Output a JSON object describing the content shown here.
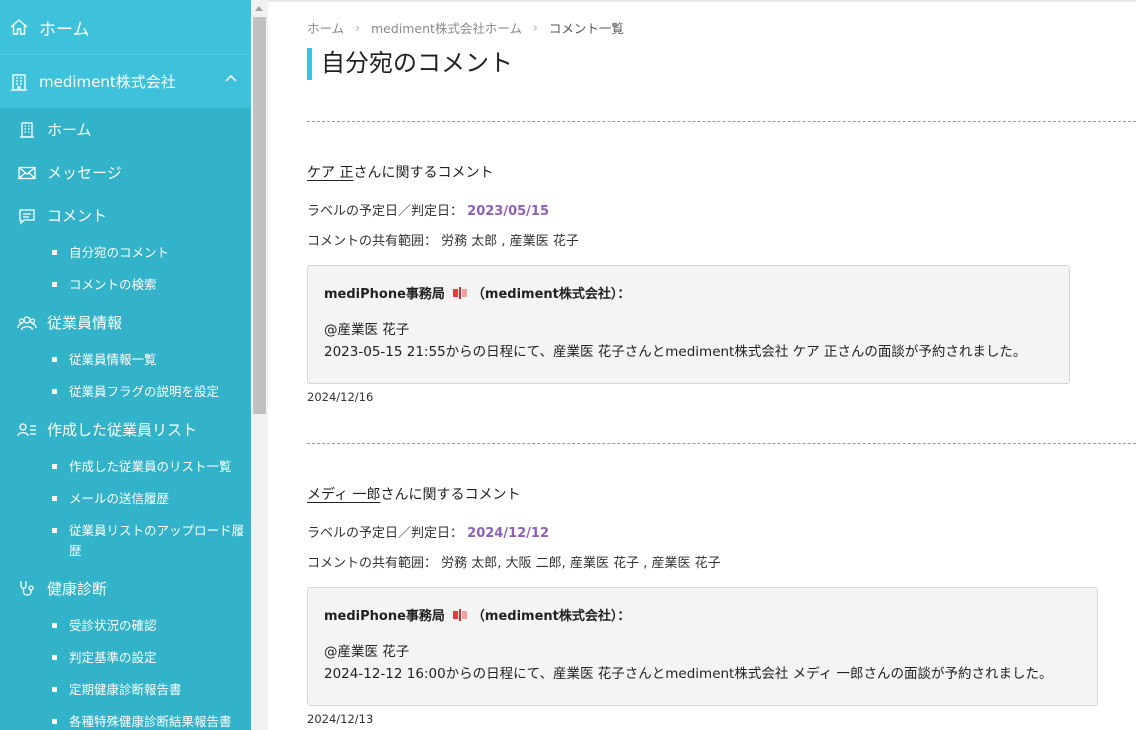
{
  "sidebar": {
    "home": "ホーム",
    "company": "mediment株式会社",
    "items": [
      {
        "label": "ホーム"
      },
      {
        "label": "メッセージ"
      },
      {
        "label": "コメント"
      },
      {
        "label": "自分宛のコメント"
      },
      {
        "label": "コメントの検索"
      },
      {
        "label": "従業員情報"
      },
      {
        "label": "従業員情報一覧"
      },
      {
        "label": "従業員フラグの説明を設定"
      },
      {
        "label": "作成した従業員リスト"
      },
      {
        "label": "作成した従業員のリスト一覧"
      },
      {
        "label": "メールの送信履歴"
      },
      {
        "label": "従業員リストのアップロード履歴"
      },
      {
        "label": "健康診断"
      },
      {
        "label": "受診状況の確認"
      },
      {
        "label": "判定基準の設定"
      },
      {
        "label": "定期健康診断報告書"
      },
      {
        "label": "各種特殊健康診断結果報告書"
      }
    ]
  },
  "breadcrumb": {
    "home": "ホーム",
    "company_home": "mediment株式会社ホーム",
    "current": "コメント一覧",
    "separator": "›"
  },
  "page": {
    "title": "自分宛のコメント"
  },
  "labels": {
    "label_date": "ラベルの予定日／判定日：",
    "share_scope": "コメントの共有範囲：",
    "about_suffix": "さんに関するコメント"
  },
  "comments": [
    {
      "employee": "ケア 正",
      "date": "2023/05/15",
      "scope": "労務 太郎 , 産業医 花子",
      "sender": "mediPhone事務局",
      "sender_org": "（mediment株式会社）：",
      "mention": "@産業医 花子",
      "body": "2023-05-15 21:55からの日程にて、産業医 花子さんとmediment株式会社 ケア 正さんの面談が予約されました。",
      "timestamp": "2024/12/16"
    },
    {
      "employee": "メディ 一郎",
      "date": "2024/12/12",
      "scope": "労務 太郎, 大阪 二郎, 産業医 花子 , 産業医 花子",
      "sender": "mediPhone事務局",
      "sender_org": "（mediment株式会社）：",
      "mention": "@産業医 花子",
      "body": "2024-12-12 16:00からの日程にて、産業医 花子さんとmediment株式会社 メディ 一郎さんの面談が予約されました。",
      "timestamp": "2024/12/13"
    }
  ],
  "colors": {
    "sidebar_bg": "#33b3c9",
    "sidebar_header": "#3ec2dc",
    "accent": "#3ec2dc",
    "date": "#8e5fb8"
  }
}
